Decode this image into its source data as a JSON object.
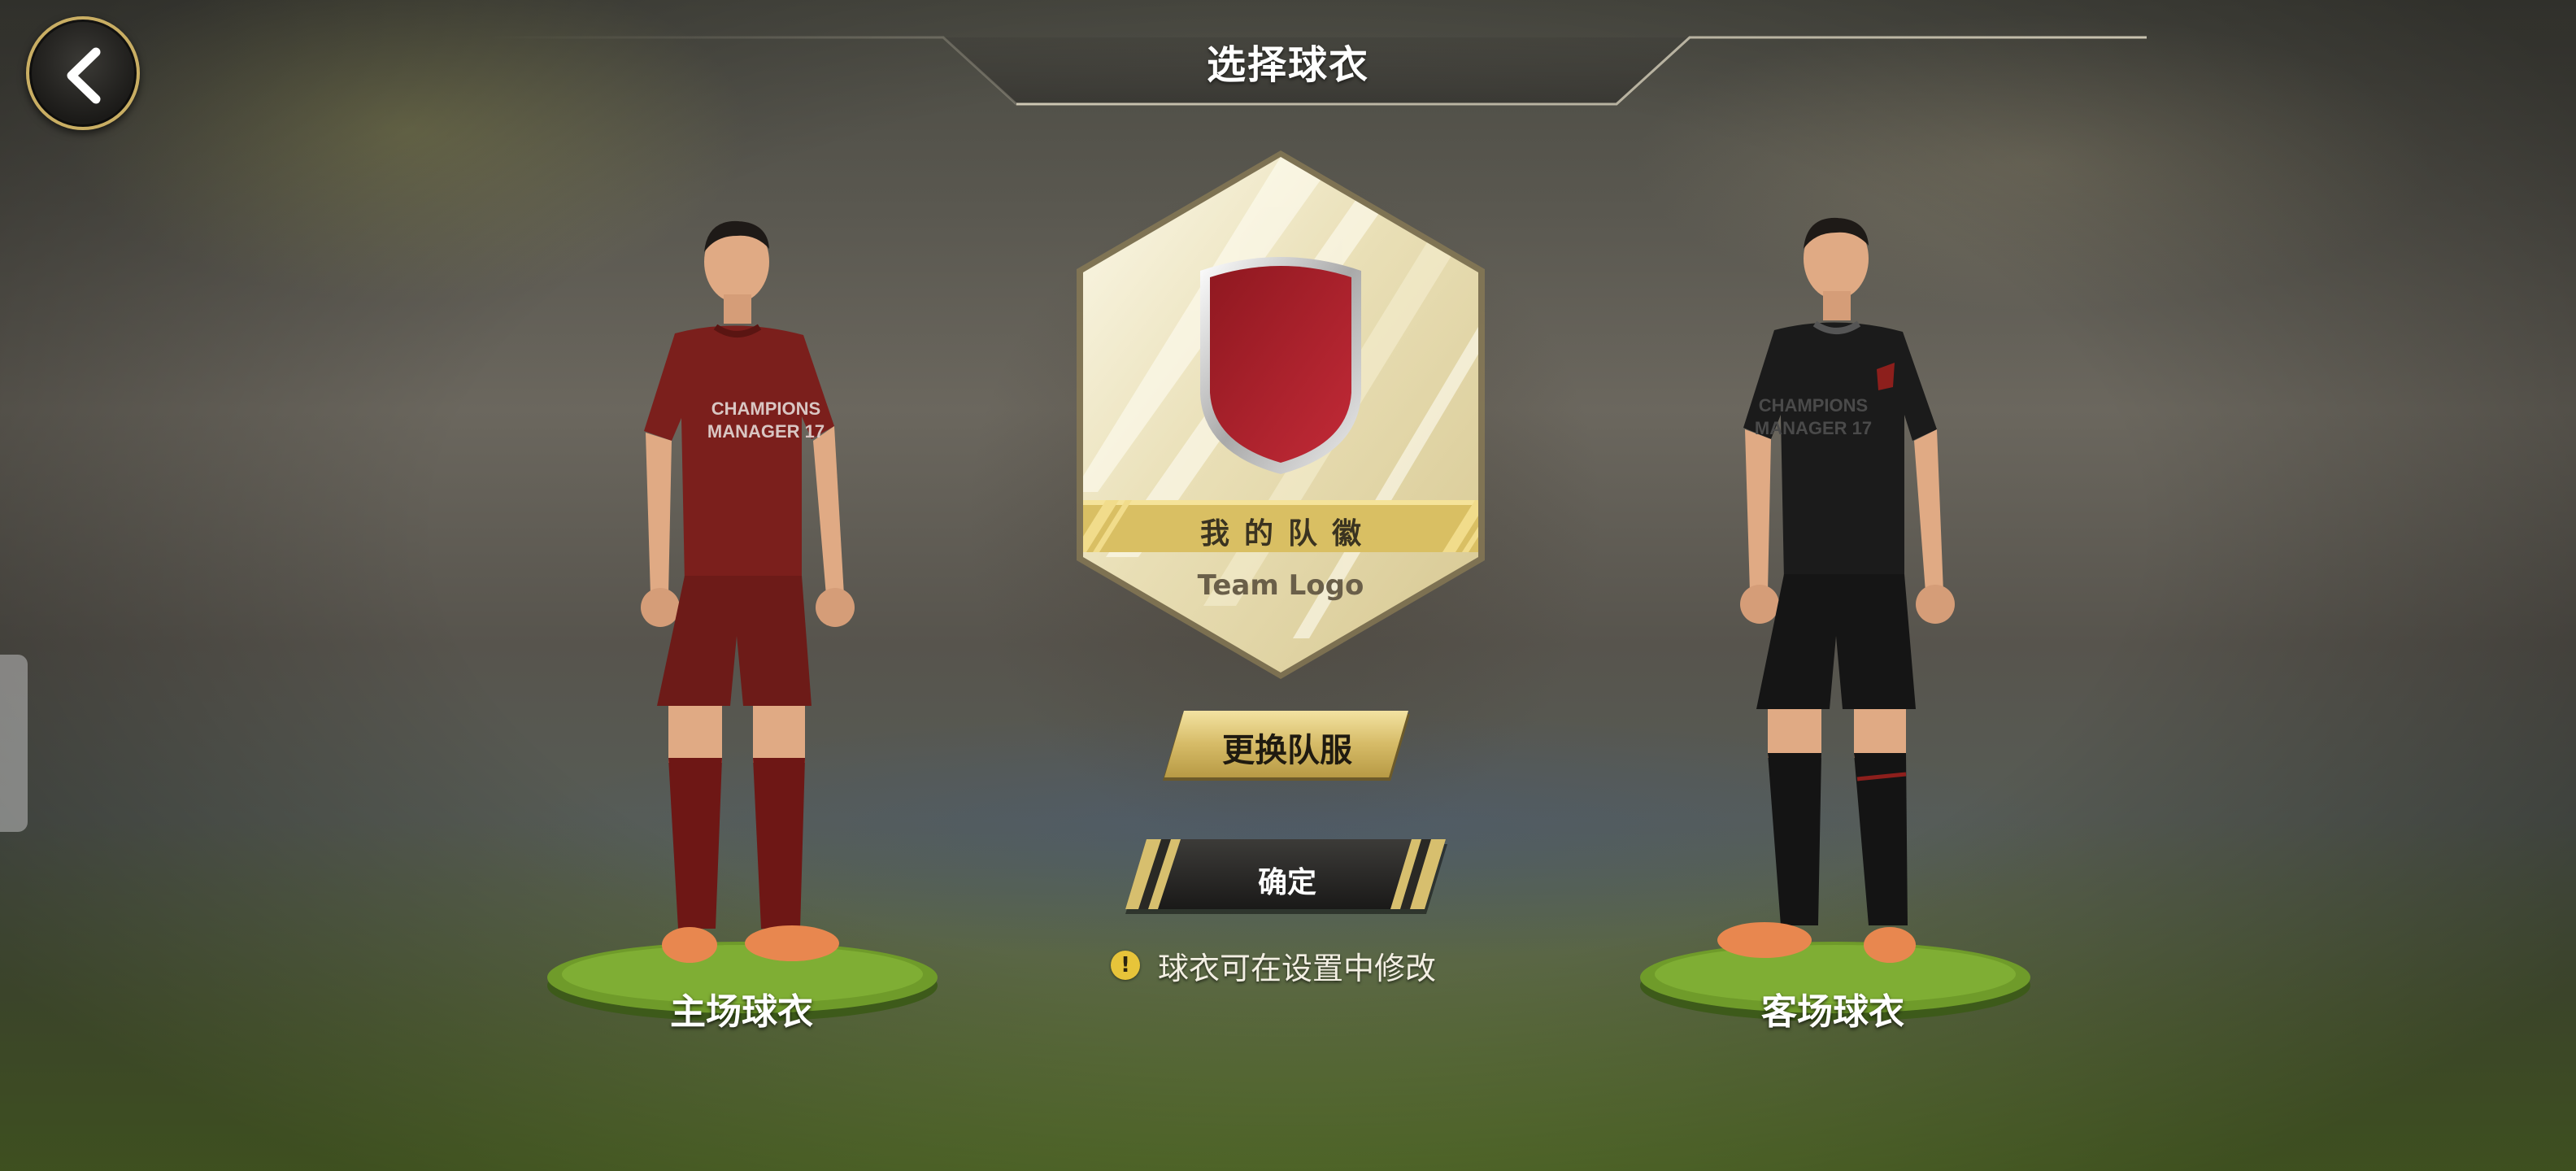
{
  "header": {
    "title": "选择球衣"
  },
  "back_button": {
    "icon": "chevron-left-icon"
  },
  "home_kit": {
    "label": "主场球衣",
    "shirt_color": "#7b1f1c",
    "sponsor_text": [
      "CHAMPIONS",
      "MANAGER 17"
    ]
  },
  "away_kit": {
    "label": "客场球衣",
    "shirt_color": "#1b1b1b",
    "sponsor_text": [
      "CHAMPIONS",
      "MANAGER 17"
    ]
  },
  "team_logo": {
    "title": "我的队徽",
    "subtitle": "Team Logo",
    "shield_color": "#b01f2b"
  },
  "actions": {
    "change_kit": "更换队服",
    "confirm": "确定"
  },
  "hint": {
    "text": "球衣可在设置中修改",
    "icon": "warning-icon"
  },
  "colors": {
    "gold": "#c9ae63",
    "dark_button": "#252422",
    "accent_red": "#b01f2b"
  }
}
